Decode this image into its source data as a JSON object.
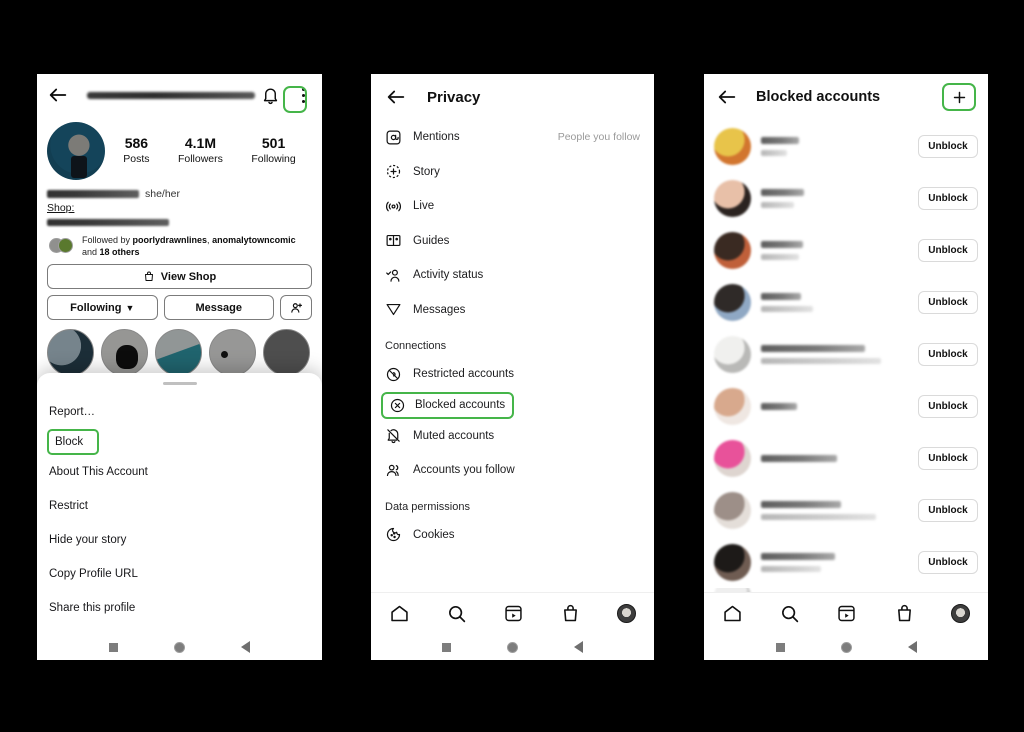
{
  "colors": {
    "highlight_green": "#45b549",
    "accent_blue": "#17658a",
    "text_primary": "#111111",
    "text_muted": "#9a9a9a"
  },
  "panel_profile": {
    "name": "profile-screen",
    "topbar": {
      "back_icon": "back-arrow-icon",
      "username_redacted": "",
      "bell_icon": "notifications-bell-icon",
      "menu_icon": "three-dots-menu-icon"
    },
    "stats": [
      {
        "value": "586",
        "label": "Posts"
      },
      {
        "value": "4.1M",
        "label": "Followers"
      },
      {
        "value": "501",
        "label": "Following"
      }
    ],
    "bio": {
      "pronouns": "she/her",
      "shop_label": "Shop:",
      "name_redacted": "",
      "bio_redacted": ""
    },
    "followed_by": {
      "prefix": "Followed by ",
      "user1": "poorlydrawnlines",
      "sep": ", ",
      "user2": "anomalytowncomic",
      "suffix": " and ",
      "others": "18 others"
    },
    "buttons": {
      "view_shop": "View Shop",
      "following": "Following",
      "following_chevron": "⌄",
      "message": "Message",
      "add_person": "add-person-icon"
    },
    "sheet": {
      "items": [
        {
          "label": "Report…",
          "highlighted": false
        },
        {
          "label": "Block",
          "highlighted": true
        },
        {
          "label": "About This Account",
          "highlighted": false
        },
        {
          "label": "Restrict",
          "highlighted": false
        },
        {
          "label": "Hide your story",
          "highlighted": false
        },
        {
          "label": "Copy Profile URL",
          "highlighted": false
        },
        {
          "label": "Share this profile",
          "highlighted": false
        }
      ]
    }
  },
  "panel_privacy": {
    "name": "privacy-settings-screen",
    "topbar": {
      "back_icon": "back-arrow-icon",
      "title": "Privacy"
    },
    "items": [
      {
        "icon": "mention-at-icon",
        "label": "Mentions",
        "value": "People you follow"
      },
      {
        "icon": "story-plus-icon",
        "label": "Story",
        "value": ""
      },
      {
        "icon": "live-broadcast-icon",
        "label": "Live",
        "value": ""
      },
      {
        "icon": "guides-book-icon",
        "label": "Guides",
        "value": ""
      },
      {
        "icon": "activity-status-icon",
        "label": "Activity status",
        "value": ""
      },
      {
        "icon": "messages-paperplane-icon",
        "label": "Messages",
        "value": ""
      }
    ],
    "section_connections": "Connections",
    "connections": [
      {
        "icon": "restricted-account-icon",
        "label": "Restricted accounts",
        "highlighted": false
      },
      {
        "icon": "blocked-circle-x-icon",
        "label": "Blocked accounts",
        "highlighted": true
      },
      {
        "icon": "muted-bell-icon",
        "label": "Muted accounts",
        "highlighted": false
      },
      {
        "icon": "people-follow-icon",
        "label": "Accounts you follow",
        "highlighted": false
      }
    ],
    "section_data": "Data permissions",
    "data_items": [
      {
        "icon": "cookie-icon",
        "label": "Cookies"
      }
    ]
  },
  "panel_blocked": {
    "name": "blocked-accounts-screen",
    "topbar": {
      "back_icon": "back-arrow-icon",
      "title": "Blocked accounts",
      "add_icon": "plus-add-icon",
      "add_highlighted": true
    },
    "unblock_label": "Unblock",
    "rows": [
      {
        "avatar": "avatar-1",
        "av_colors": [
          "#e8c44a",
          "#d2762f"
        ],
        "name_w": 38,
        "handle_w": 26,
        "has_handle": true
      },
      {
        "avatar": "avatar-2",
        "av_colors": [
          "#e8c0a8",
          "#2b2320"
        ],
        "name_w": 43,
        "handle_w": 33,
        "has_handle": true
      },
      {
        "avatar": "avatar-3",
        "av_colors": [
          "#3a2a22",
          "#c0603a"
        ],
        "name_w": 42,
        "handle_w": 38,
        "has_handle": true
      },
      {
        "avatar": "avatar-4",
        "av_colors": [
          "#2f2a28",
          "#8fa8c4"
        ],
        "name_w": 40,
        "handle_w": 52,
        "has_handle": true
      },
      {
        "avatar": "avatar-5",
        "av_colors": [
          "#f0f0ee",
          "#b9b9b7"
        ],
        "name_w": 104,
        "handle_w": 120,
        "has_handle": true
      },
      {
        "avatar": "avatar-6",
        "av_colors": [
          "#d8a98d",
          "#efe7e2"
        ],
        "name_w": 36,
        "handle_w": 0,
        "has_handle": false
      },
      {
        "avatar": "avatar-7",
        "av_colors": [
          "#e8529a",
          "#ded5d0"
        ],
        "name_w": 76,
        "handle_w": 0,
        "has_handle": false
      },
      {
        "avatar": "avatar-8",
        "av_colors": [
          "#9d8f88",
          "#e4ded9"
        ],
        "name_w": 80,
        "handle_w": 115,
        "has_handle": true
      },
      {
        "avatar": "avatar-9",
        "av_colors": [
          "#1d1a18",
          "#6f5c52"
        ],
        "name_w": 74,
        "handle_w": 60,
        "has_handle": true
      }
    ]
  },
  "bottom_nav": {
    "items": [
      {
        "icon": "home-icon"
      },
      {
        "icon": "search-icon"
      },
      {
        "icon": "reels-icon"
      },
      {
        "icon": "shop-bag-icon"
      },
      {
        "icon": "profile-avatar-icon"
      }
    ]
  },
  "android_nav": {
    "recents": "square-recents-icon",
    "home": "circle-home-icon",
    "back": "triangle-back-icon"
  }
}
